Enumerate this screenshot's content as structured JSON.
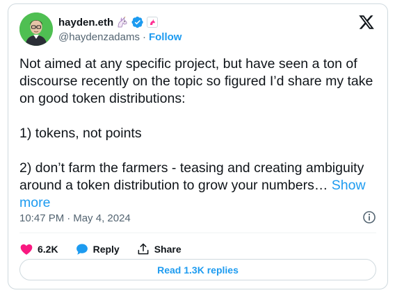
{
  "author": {
    "display_name": "hayden.eth",
    "handle": "@haydenzadams",
    "separator": "·",
    "follow_label": "Follow"
  },
  "tweet": {
    "text": "Not aimed at any specific project, but have seen a ton of discourse recently on the topic so figured I’d share my take on good token distributions:\n\n1) tokens, not points\n\n2) don’t farm the farmers - teasing and creating ambiguity around a token distribution to grow your numbers… ",
    "show_more_label": "Show more",
    "time": "10:47 PM",
    "separator": "·",
    "date": "May 4, 2024"
  },
  "actions": {
    "likes_count": "6.2K",
    "reply_label": "Reply",
    "share_label": "Share"
  },
  "footer": {
    "read_replies_label": "Read 1.3K replies"
  },
  "colors": {
    "accent": "#1d9bf0",
    "like": "#f91880",
    "secondary_text": "#536471",
    "border": "#cfd9de"
  },
  "icons": [
    "unicorn-emoji-icon",
    "verified-badge-icon",
    "affiliate-badge-icon",
    "x-logo-icon",
    "info-icon",
    "heart-icon",
    "reply-bubble-icon",
    "share-icon"
  ]
}
